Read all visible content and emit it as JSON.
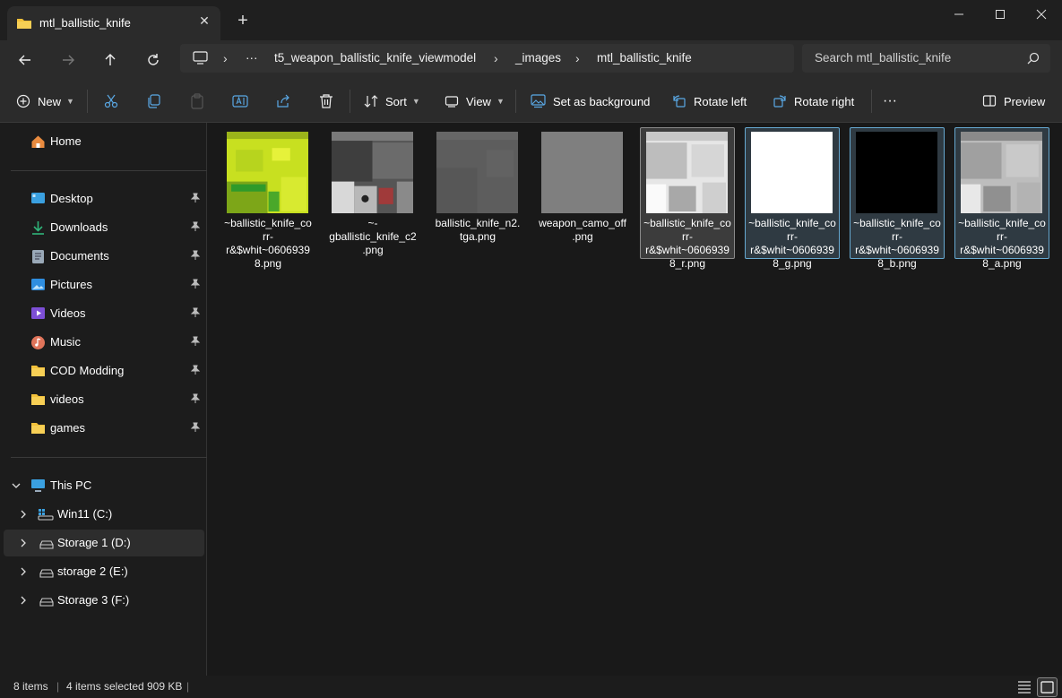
{
  "window": {
    "tab_title": "mtl_ballistic_knife",
    "new_tab": "+",
    "close_tab": "✕"
  },
  "address": {
    "more": "···",
    "crumbs": [
      "t5_weapon_ballistic_knife_viewmodel",
      "_images",
      "mtl_ballistic_knife"
    ]
  },
  "search": {
    "placeholder": "Search mtl_ballistic_knife"
  },
  "toolbar": {
    "new_label": "New",
    "sort_label": "Sort",
    "view_label": "View",
    "set_bg_label": "Set as background",
    "rotate_left_label": "Rotate left",
    "rotate_right_label": "Rotate right",
    "more_label": "···",
    "preview_label": "Preview"
  },
  "sidebar": {
    "home": "Home",
    "quick_access": [
      {
        "label": "Desktop",
        "icon": "desktop-icon"
      },
      {
        "label": "Downloads",
        "icon": "download-icon"
      },
      {
        "label": "Documents",
        "icon": "document-icon"
      },
      {
        "label": "Pictures",
        "icon": "pictures-icon"
      },
      {
        "label": "Videos",
        "icon": "videos-icon"
      },
      {
        "label": "Music",
        "icon": "music-icon"
      },
      {
        "label": "COD Modding",
        "icon": "folder-icon"
      },
      {
        "label": "videos",
        "icon": "folder-icon"
      },
      {
        "label": "games",
        "icon": "folder-icon"
      }
    ],
    "this_pc": "This PC",
    "drives": [
      {
        "label": "Win11 (C:)",
        "icon": "windows-drive-icon"
      },
      {
        "label": "Storage 1 (D:)",
        "icon": "drive-icon"
      },
      {
        "label": "storage 2 (E:)",
        "icon": "drive-icon"
      },
      {
        "label": "Storage 3 (F:)",
        "icon": "drive-icon"
      }
    ]
  },
  "files": [
    {
      "name": "~ballistic_knife_corr-r&$whit~06069398.png",
      "selected": false
    },
    {
      "name": "~-gballistic_knife_c2.png",
      "selected": false
    },
    {
      "name": "ballistic_knife_n2.tga.png",
      "selected": false
    },
    {
      "name": "weapon_camo_off.png",
      "selected": false
    },
    {
      "name": "~ballistic_knife_corr-r&$whit~06069398_r.png",
      "selected": true
    },
    {
      "name": "~ballistic_knife_corr-r&$whit~06069398_g.png",
      "selected": true
    },
    {
      "name": "~ballistic_knife_corr-r&$whit~06069398_b.png",
      "selected": true
    },
    {
      "name": "~ballistic_knife_corr-r&$whit~06069398_a.png",
      "selected": true
    }
  ],
  "status": {
    "item_count": "8 items",
    "selected": "4 items selected",
    "size": "909 KB"
  },
  "colors": {
    "folder": "#f3c13a",
    "accent": "#66a9d1"
  }
}
